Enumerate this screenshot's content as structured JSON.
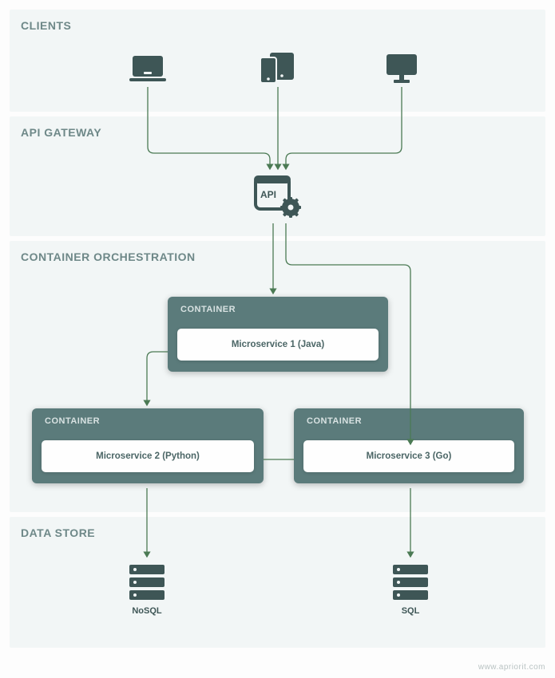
{
  "sections": {
    "clients": {
      "title": "CLIENTS"
    },
    "gateway": {
      "title": "API GATEWAY",
      "api_label": "API"
    },
    "orchestration": {
      "title": "CONTAINER ORCHESTRATION"
    },
    "datastore": {
      "title": "DATA STORE"
    }
  },
  "containers": [
    {
      "title": "CONTAINER",
      "service": "Microservice 1 (Java)"
    },
    {
      "title": "CONTAINER",
      "service": "Microservice 2 (Python)"
    },
    {
      "title": "CONTAINER",
      "service": "Microservice 3 (Go)"
    }
  ],
  "datastores": [
    {
      "label": "NoSQL"
    },
    {
      "label": "SQL"
    }
  ],
  "footer": "www.apriorit.com",
  "colors": {
    "teal_dark": "#3e5656",
    "teal_mid": "#5b7b7b",
    "teal_light": "#6e8888",
    "panel": "#f2f6f6",
    "arrow": "#4b7a54"
  }
}
